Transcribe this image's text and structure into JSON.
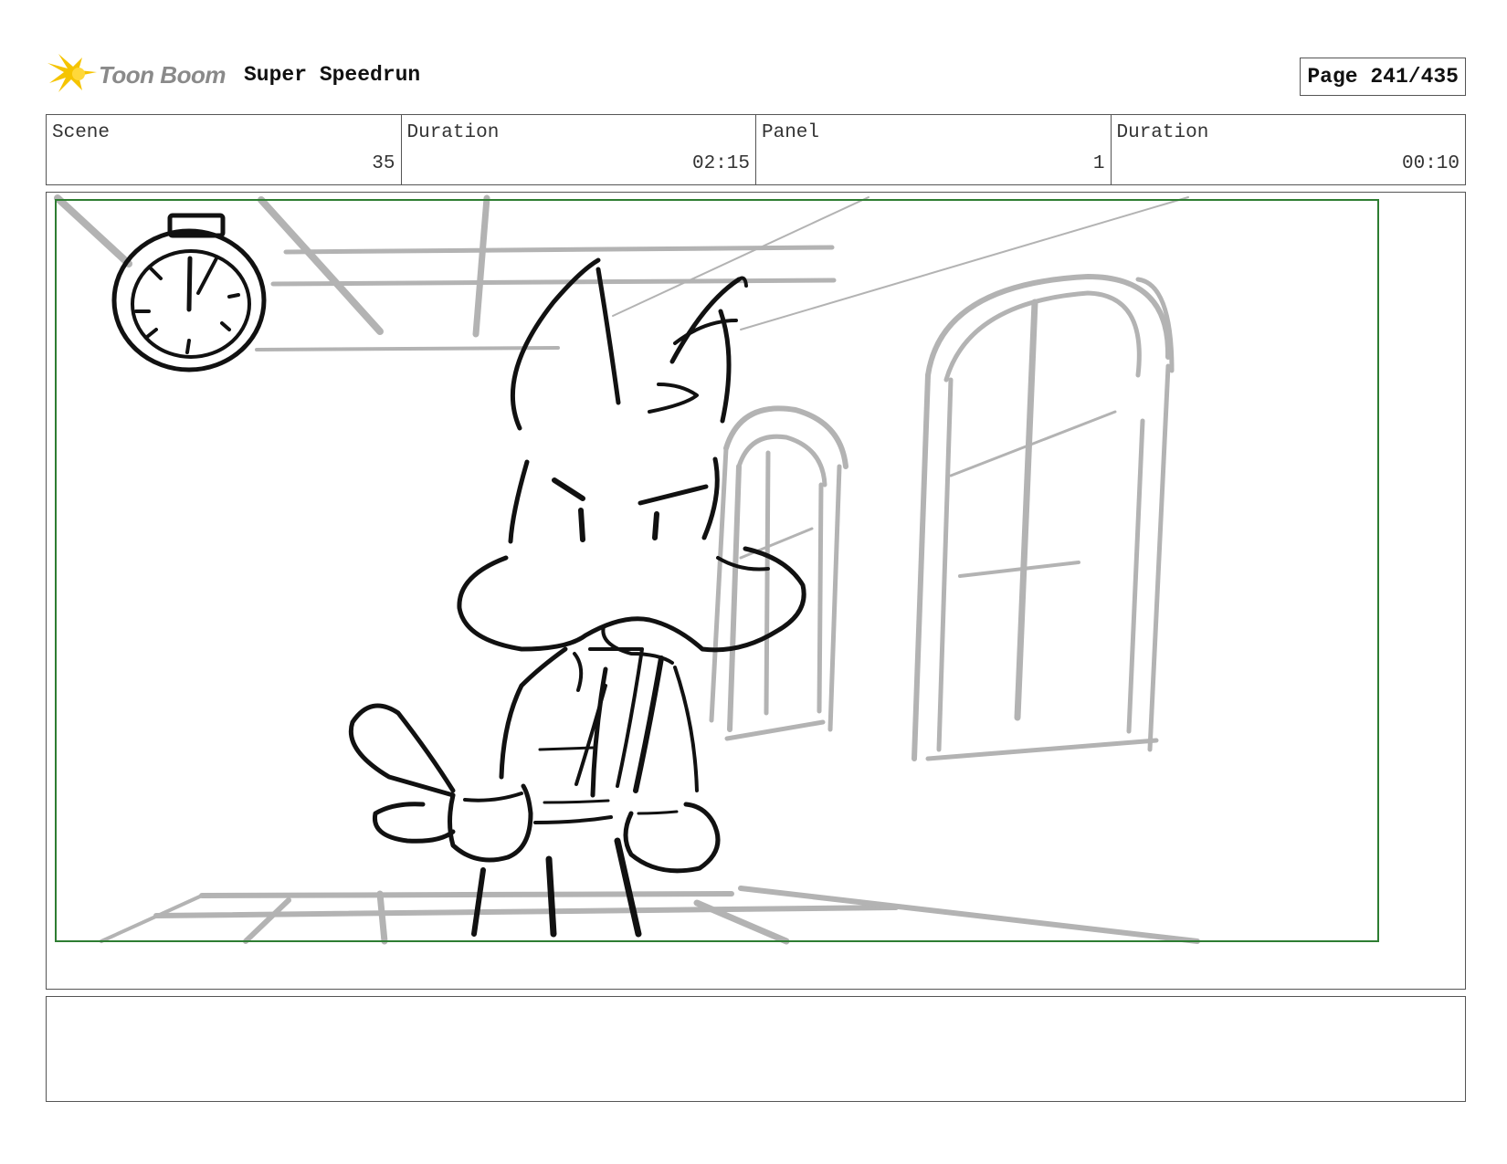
{
  "header": {
    "logo_text": "Toon Boom",
    "project_title": "Super Speedrun",
    "page_label": "Page 241/435"
  },
  "info": [
    {
      "label": "Scene",
      "value": "35"
    },
    {
      "label": "Duration",
      "value": "02:15"
    },
    {
      "label": "Panel",
      "value": "1"
    },
    {
      "label": "Duration",
      "value": "00:10"
    }
  ],
  "panel": {
    "safe_area_color": "#2e7d32",
    "sketch_color": "#111111",
    "background_color": "#b3b3b3"
  },
  "notes": {
    "text": ""
  }
}
